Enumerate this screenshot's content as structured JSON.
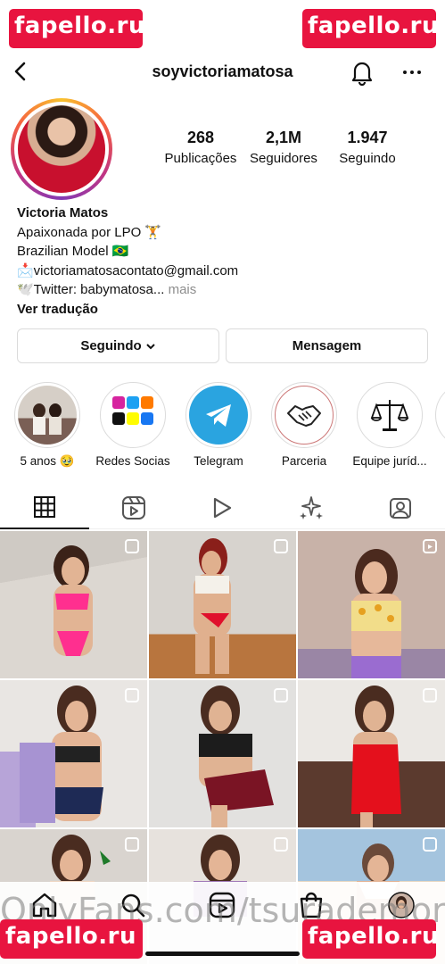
{
  "watermarks": {
    "text": "fapello.ru"
  },
  "header": {
    "username": "soyvictoriamatosa"
  },
  "stats": [
    {
      "value": "268",
      "label": "Publicações"
    },
    {
      "value": "2,1M",
      "label": "Seguidores"
    },
    {
      "value": "1.947",
      "label": "Seguindo"
    }
  ],
  "bio": {
    "name": "Victoria Matos",
    "line1": "Apaixonada por LPO 🏋️",
    "line2": "Brazilian Model 🇧🇷",
    "line3": "📩victoriamatosacontato@gmail.com",
    "line4": "🕊️Twitter: babymatosa...",
    "more": " mais",
    "translate": "Ver tradução"
  },
  "buttons": {
    "following": "Seguindo",
    "message": "Mensagem"
  },
  "highlights": [
    {
      "label": "5 anos 🥹"
    },
    {
      "label": "Redes Socias"
    },
    {
      "label": "Telegram"
    },
    {
      "label": "Parceria"
    },
    {
      "label": "Equipe juríd..."
    }
  ],
  "overlay": {
    "text": "OnlyFans.com/tsurademore"
  },
  "colors": {
    "accent_red": "#e8143f",
    "telegram_blue": "#2aa4e0",
    "divider": "#dbdbdb",
    "muted": "#8e8e8e"
  }
}
